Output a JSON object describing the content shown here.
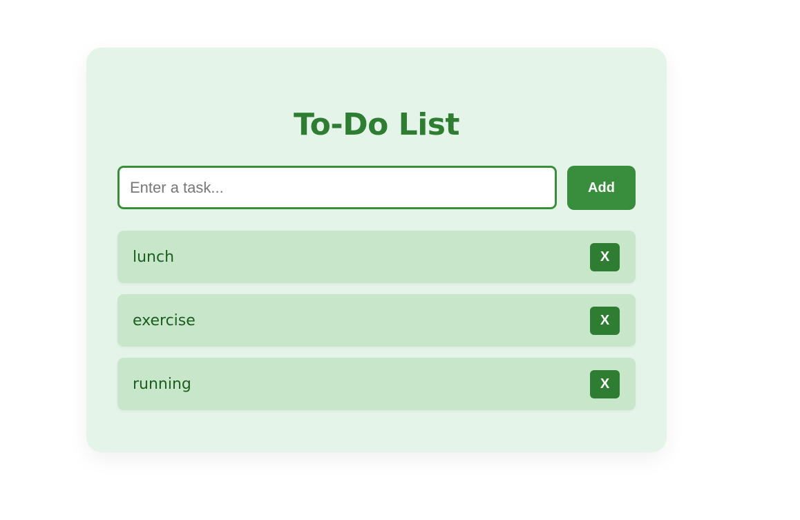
{
  "app": {
    "title": "To-Do List"
  },
  "form": {
    "input_value": "",
    "input_placeholder": "Enter a task...",
    "add_label": "Add"
  },
  "tasks": [
    {
      "label": "lunch",
      "delete_label": "X"
    },
    {
      "label": "exercise",
      "delete_label": "X"
    },
    {
      "label": "running",
      "delete_label": "X"
    }
  ],
  "colors": {
    "page_background": "#ffffff",
    "card_background": "#e5f4e8",
    "accent": "#388e3c",
    "title": "#2e7d32",
    "task_background": "#c8e6c9",
    "task_text": "#1b5e20",
    "delete_button": "#2e7d32"
  }
}
